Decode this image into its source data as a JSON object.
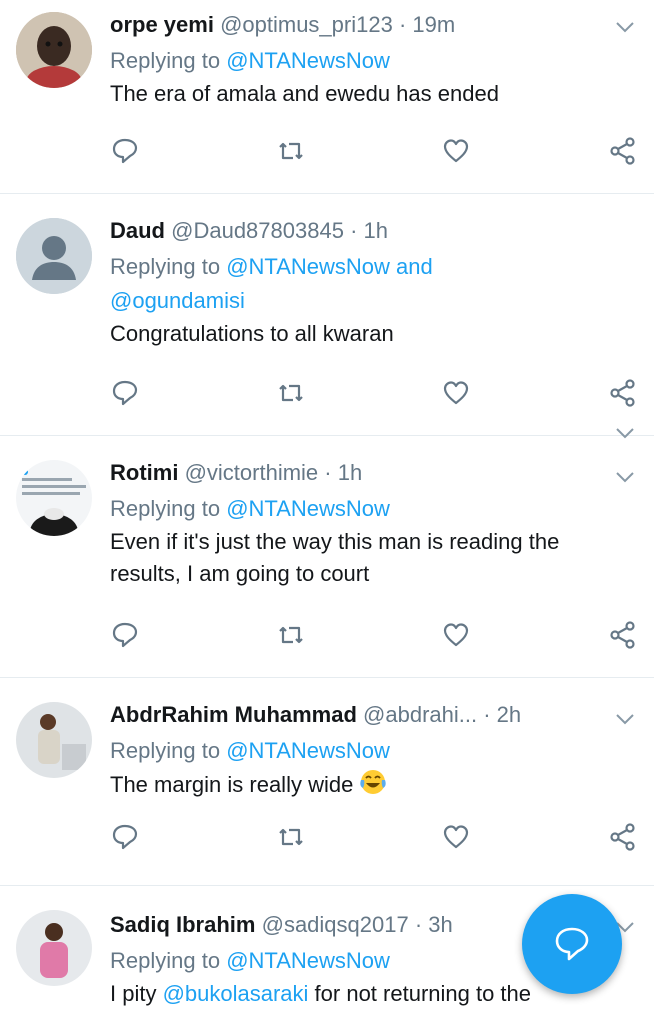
{
  "colors": {
    "accent": "#1da1f2",
    "muted": "#657786",
    "text": "#14171a",
    "divider": "#e6ecf0"
  },
  "tweets": [
    {
      "name": "orpe yemi",
      "handle": "@optimus_pri123",
      "time": "· 19m",
      "replying_prefix": "Replying to ",
      "replying_to": "@NTANewsNow",
      "replying_line2": "",
      "text_lines": [
        "The era of amala and ewedu has ended"
      ],
      "avatar_icon": "child-photo-avatar"
    },
    {
      "name": "Daud",
      "handle": "@Daud87803845",
      "time": "· 1h",
      "replying_prefix": "Replying to ",
      "replying_to": "@NTANewsNow and",
      "replying_line2": "@ogundamisi",
      "text_lines": [
        "Congratulations to all kwaran"
      ],
      "avatar_icon": "default-avatar"
    },
    {
      "name": "Rotimi",
      "handle": "@victorthimie",
      "time": "· 1h",
      "replying_prefix": "Replying to ",
      "replying_to": "@NTANewsNow",
      "replying_line2": "",
      "text_lines": [
        "Even if it's just the way this man is reading the",
        "results, I am going to court"
      ],
      "avatar_icon": "screenshot-avatar"
    },
    {
      "name": "AbdrRahim Muhammad",
      "handle": "@abdrahi...",
      "time": "· 2h",
      "replying_prefix": "Replying to ",
      "replying_to": "@NTANewsNow",
      "replying_line2": "",
      "text_lines": [
        "The margin is really wide"
      ],
      "avatar_icon": "person-photo-avatar"
    },
    {
      "name": "Sadiq Ibrahim",
      "handle": "@sadiqsq2017",
      "time": "· 3h",
      "replying_prefix": "Replying to ",
      "replying_to": "@NTANewsNow",
      "replying_line2": "",
      "text_prefix": "I pity ",
      "text_mention": "@bukolasaraki",
      "text_suffix": " for not returning to the",
      "avatar_icon": "person-photo-avatar"
    }
  ],
  "icons": {
    "reply": "reply-icon",
    "retweet": "retweet-icon",
    "like": "heart-icon",
    "share": "share-icon",
    "menu": "chevron-down-icon",
    "compose": "compose-reply-icon"
  },
  "emoji": "tears-of-joy"
}
